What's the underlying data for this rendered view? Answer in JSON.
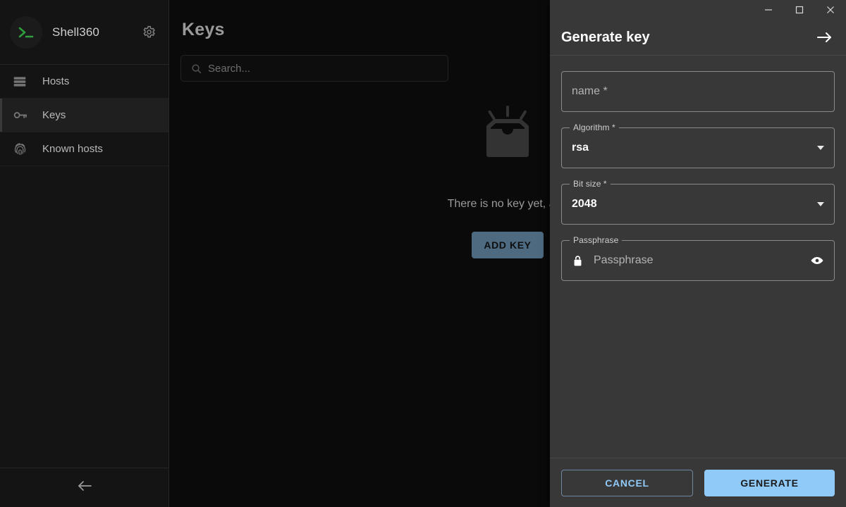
{
  "app": {
    "brand_name": "Shell360",
    "logo_icon": "terminal-prompt-icon",
    "settings_icon": "gear-icon",
    "back_icon": "arrow-left-icon"
  },
  "sidebar": {
    "items": [
      {
        "label": "Hosts",
        "icon": "server-rack-icon",
        "active": false
      },
      {
        "label": "Keys",
        "icon": "key-icon",
        "active": true
      },
      {
        "label": "Known hosts",
        "icon": "fingerprint-icon",
        "active": false
      }
    ]
  },
  "main": {
    "title": "Keys",
    "search": {
      "placeholder": "Search...",
      "value": "",
      "icon": "search-icon"
    },
    "empty_state": {
      "icon": "empty-inbox-icon",
      "message": "There is no key yet, add",
      "button_label": "ADD KEY"
    }
  },
  "panel": {
    "title": "Generate key",
    "collapse_icon": "arrow-right-icon",
    "window_controls": {
      "minimize": "minimize-icon",
      "maximize": "maximize-icon",
      "close": "close-icon"
    },
    "fields": {
      "name": {
        "placeholder": "name *",
        "value": ""
      },
      "algorithm": {
        "legend": "Algorithm *",
        "value": "rsa",
        "caret": "chevron-down-icon"
      },
      "bit_size": {
        "legend": "Bit size *",
        "value": "2048",
        "caret": "chevron-down-icon"
      },
      "passphrase": {
        "legend": "Passphrase",
        "placeholder": "Passphrase",
        "value": "",
        "lock_icon": "lock-icon",
        "reveal_icon": "eye-icon"
      }
    },
    "footer": {
      "cancel_label": "CANCEL",
      "generate_label": "GENERATE"
    }
  },
  "colors": {
    "accent": "#90caf9",
    "panel_bg": "#383838",
    "sidebar_bg": "#141414",
    "main_bg": "#0a0a0a",
    "logo_green": "#2e9e3e"
  }
}
